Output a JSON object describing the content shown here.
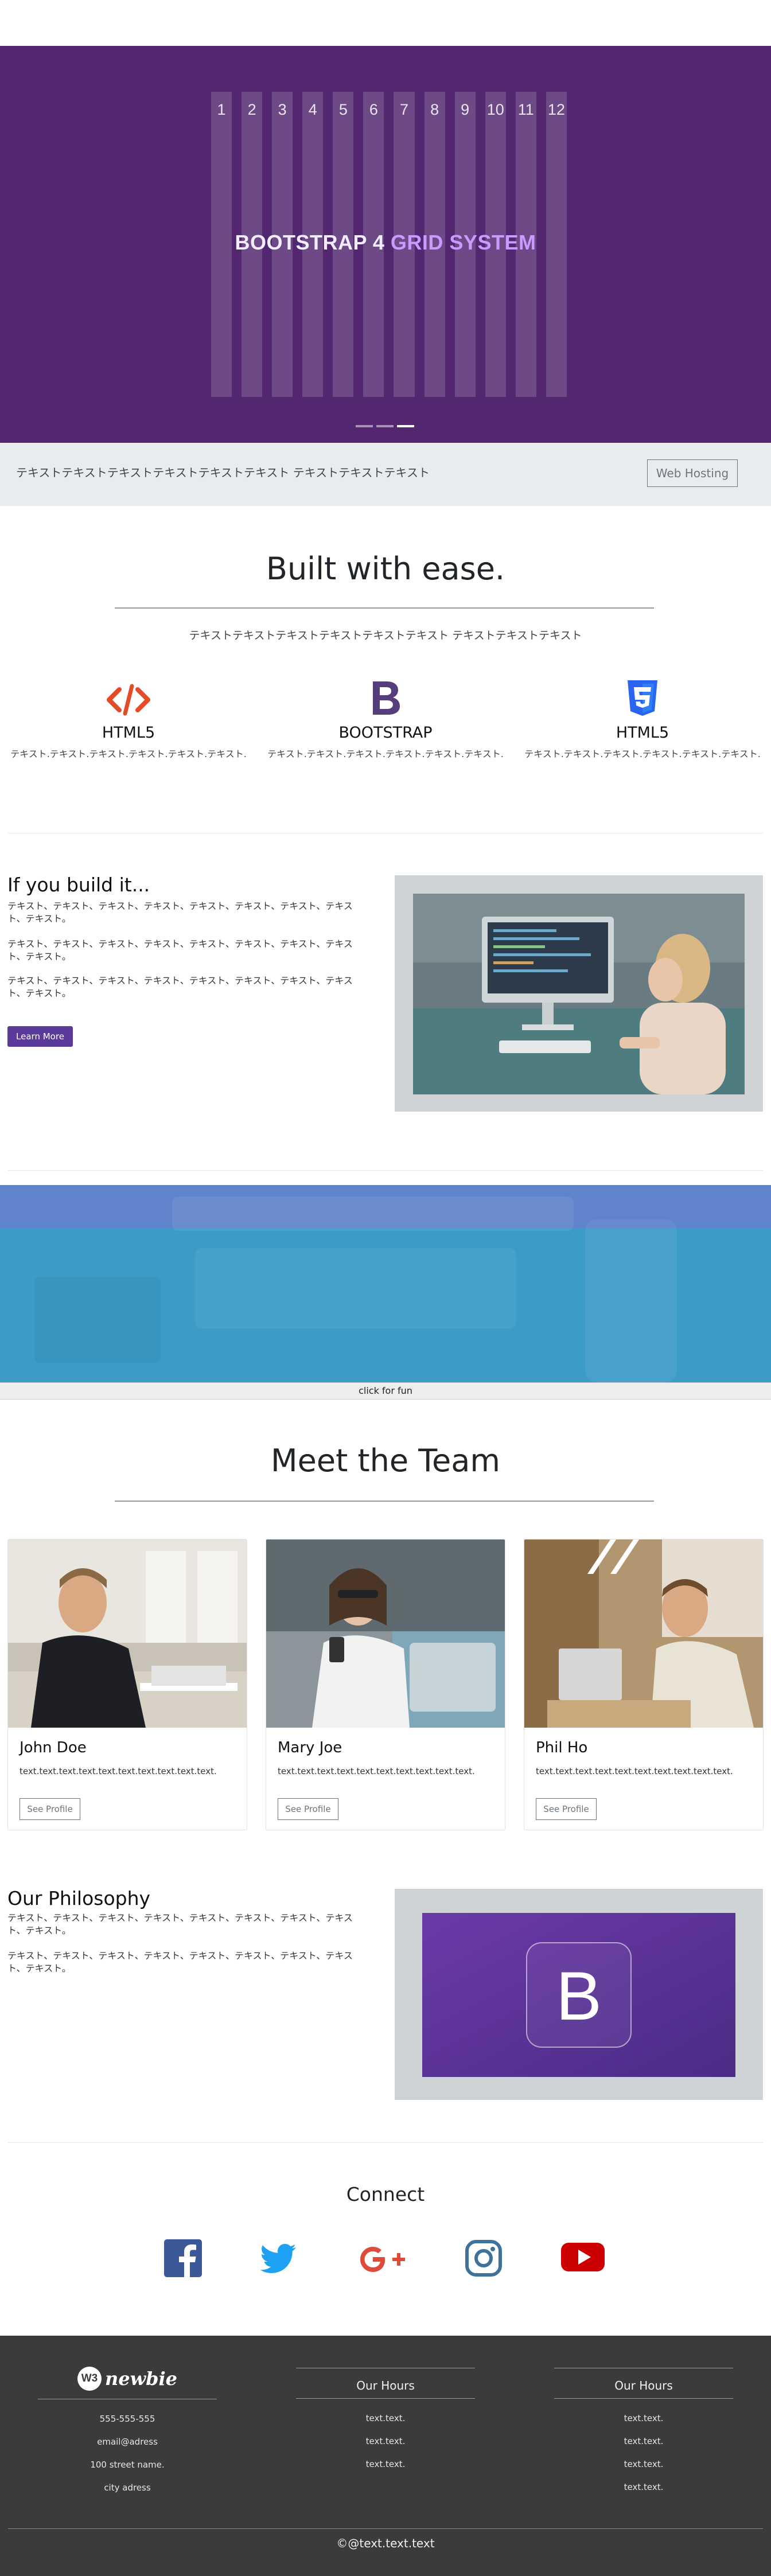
{
  "hero": {
    "grid_numbers": [
      "1",
      "2",
      "3",
      "4",
      "5",
      "6",
      "7",
      "8",
      "9",
      "10",
      "11",
      "12"
    ],
    "title_main": "BOOTSTRAP 4 ",
    "title_accent": "GRID SYSTEM",
    "indicator_count": 3,
    "active_indicator": 3
  },
  "infobar": {
    "text": "テキストテキストテキストテキストテキストテキスト テキストテキストテキスト",
    "button_label": "Web Hosting"
  },
  "built": {
    "title": "Built with ease.",
    "subtitle": "テキストテキストテキストテキストテキストテキスト テキストテキストテキスト",
    "features": [
      {
        "icon": "html5-code-icon",
        "title": "HTML5",
        "desc": "テキスト.テキスト.テキスト.テキスト.テキスト.テキスト.",
        "color": "#e34c26"
      },
      {
        "icon": "bootstrap-icon",
        "title": "BOOTSTRAP",
        "desc": "テキスト.テキスト.テキスト.テキスト.テキスト.テキスト.",
        "color": "#563d7c"
      },
      {
        "icon": "css3-icon",
        "title": "HTML5",
        "desc": "テキスト.テキスト.テキスト.テキスト.テキスト.テキスト.",
        "color": "#2965f1"
      }
    ]
  },
  "build_it": {
    "title": "If you build it...",
    "paragraphs": [
      "テキスト、テキスト、テキスト、テキスト、テキスト、テキスト、テキスト、テキスト、テキスト。",
      "テキスト、テキスト、テキスト、テキスト、テキスト、テキスト、テキスト、テキスト、テキスト。",
      "テキスト、テキスト、テキスト、テキスト、テキスト、テキスト、テキスト、テキスト、テキスト。"
    ],
    "button_label": "Learn More"
  },
  "fun_bar": {
    "label": "click for fun"
  },
  "team": {
    "title": "Meet the Team",
    "members": [
      {
        "name": "John Doe",
        "text": "text.text.text.text.text.text.text.text.text.text.",
        "button": "See Profile"
      },
      {
        "name": "Mary Joe",
        "text": "text.text.text.text.text.text.text.text.text.text.",
        "button": "See Profile"
      },
      {
        "name": "Phil Ho",
        "text": "text.text.text.text.text.text.text.text.text.text.",
        "button": "See Profile"
      }
    ]
  },
  "philosophy": {
    "title": "Our Philosophy",
    "paragraphs": [
      "テキスト、テキスト、テキスト、テキスト、テキスト、テキスト、テキスト、テキスト、テキスト。",
      "テキスト、テキスト、テキスト、テキスト、テキスト、テキスト、テキスト、テキスト、テキスト。"
    ],
    "logo_letter": "B"
  },
  "connect": {
    "title": "Connect",
    "icons": [
      {
        "name": "facebook-icon",
        "color": "#3b5998"
      },
      {
        "name": "twitter-icon",
        "color": "#1da1f2"
      },
      {
        "name": "google-plus-icon",
        "color": "#dd4b39"
      },
      {
        "name": "instagram-icon",
        "color": "#3f729b"
      },
      {
        "name": "youtube-icon",
        "color": "#cc0000"
      }
    ]
  },
  "footer": {
    "logo_badge": "W3",
    "logo_text": "newbie",
    "contact": [
      "555-555-555",
      "email@adress",
      "100 street name.",
      "city adress"
    ],
    "hours_1": {
      "title": "Our Hours",
      "items": [
        "text.text.",
        "text.text.",
        "text.text."
      ]
    },
    "hours_2": {
      "title": "Our Hours",
      "items": [
        "text.text.",
        "text.text.",
        "text.text.",
        "text.text."
      ]
    },
    "copyright": "©@text.text.text"
  },
  "colors": {
    "brand_purple": "#563d7c",
    "hero_bg": "#52276f",
    "footer_bg": "#3b3b3b"
  }
}
